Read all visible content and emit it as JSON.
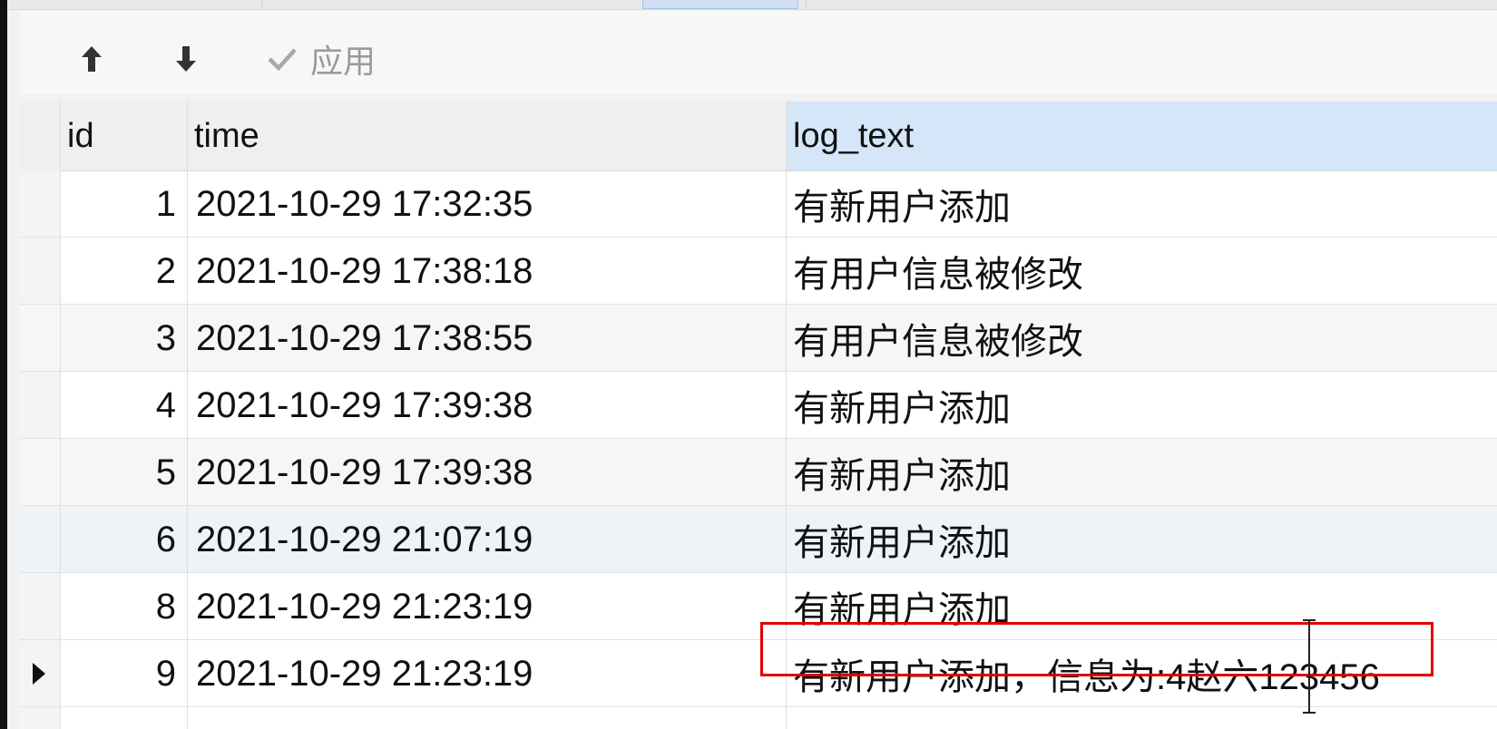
{
  "toolbar": {
    "move_up_icon": "arrow-up-icon",
    "move_down_icon": "arrow-down-icon",
    "apply_icon": "check-icon",
    "apply_label": "应用"
  },
  "table": {
    "columns": [
      "id",
      "time",
      "log_text"
    ],
    "rows": [
      {
        "id": "1",
        "time": "2021-10-29 17:32:35",
        "log_text": "有新用户添加"
      },
      {
        "id": "2",
        "time": "2021-10-29 17:38:18",
        "log_text": "有用户信息被修改"
      },
      {
        "id": "3",
        "time": "2021-10-29 17:38:55",
        "log_text": "有用户信息被修改"
      },
      {
        "id": "4",
        "time": "2021-10-29 17:39:38",
        "log_text": "有新用户添加"
      },
      {
        "id": "5",
        "time": "2021-10-29 17:39:38",
        "log_text": "有新用户添加"
      },
      {
        "id": "6",
        "time": "2021-10-29 21:07:19",
        "log_text": "有新用户添加"
      },
      {
        "id": "8",
        "time": "2021-10-29 21:23:19",
        "log_text": "有新用户添加"
      },
      {
        "id": "9",
        "time": "2021-10-29 21:23:19",
        "log_text": "有新用户添加，信息为:4赵六123456"
      }
    ]
  },
  "colors": {
    "highlight_box": "#e00000",
    "selected_header": "#d4e6f7"
  }
}
